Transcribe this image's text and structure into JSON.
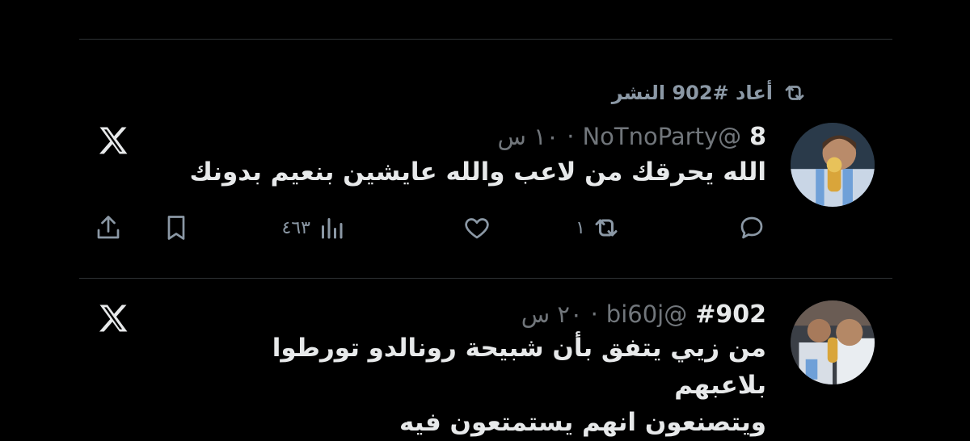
{
  "retweet_banner": {
    "text": "أعاد #902 النشر"
  },
  "tweets": [
    {
      "name": "8",
      "handle": "@NoTnoParty",
      "separator": "·",
      "time": "١٠ س",
      "text": "الله يحرقك من لاعب والله عايشين بنعيم بدونك",
      "actions": {
        "reply": "",
        "retweet": "١",
        "like": "",
        "views": "٤٦٣"
      }
    },
    {
      "name": "#902",
      "handle": "@bi60j",
      "separator": "·",
      "time": "٢٠ س",
      "text_lines": [
        "من زيي يتفق بأن شبيحة رونالدو تورطوا بلاعبهم",
        "ويتصنعون انهم يستمتعون فيه"
      ]
    }
  ],
  "colors": {
    "background": "#000000",
    "text": "#e7e9ea",
    "muted": "#71767b",
    "divider": "#2f3336"
  },
  "icons": [
    "retweet-icon",
    "x-logo-icon",
    "reply-icon",
    "like-icon",
    "views-icon",
    "bookmark-icon",
    "share-icon"
  ]
}
